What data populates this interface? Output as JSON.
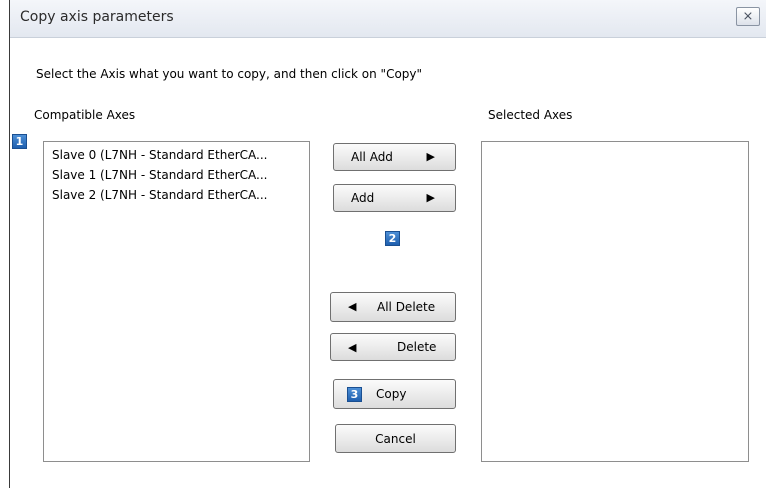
{
  "window": {
    "title": "Copy axis parameters",
    "close_glyph": "⨯"
  },
  "instruction": "Select the Axis what you want to copy, and then click on \"Copy\"",
  "compatible": {
    "label": "Compatible Axes",
    "items": [
      "Slave 0 (L7NH - Standard EtherCA...",
      "Slave 1 (L7NH - Standard EtherCA...",
      "Slave 2 (L7NH - Standard EtherCA..."
    ]
  },
  "selected": {
    "label": "Selected Axes",
    "items": []
  },
  "buttons": {
    "all_add": "All Add",
    "add": "Add",
    "all_delete": "All Delete",
    "delete": "Delete",
    "copy": "Copy",
    "cancel": "Cancel",
    "right_arrow_icon": "▶",
    "left_arrow_icon": "◀"
  },
  "step_badges": {
    "one": "1",
    "two": "2",
    "three": "3"
  },
  "colors": {
    "badge_blue": "#2f74c4",
    "titlebar": "#e8ecf2"
  }
}
